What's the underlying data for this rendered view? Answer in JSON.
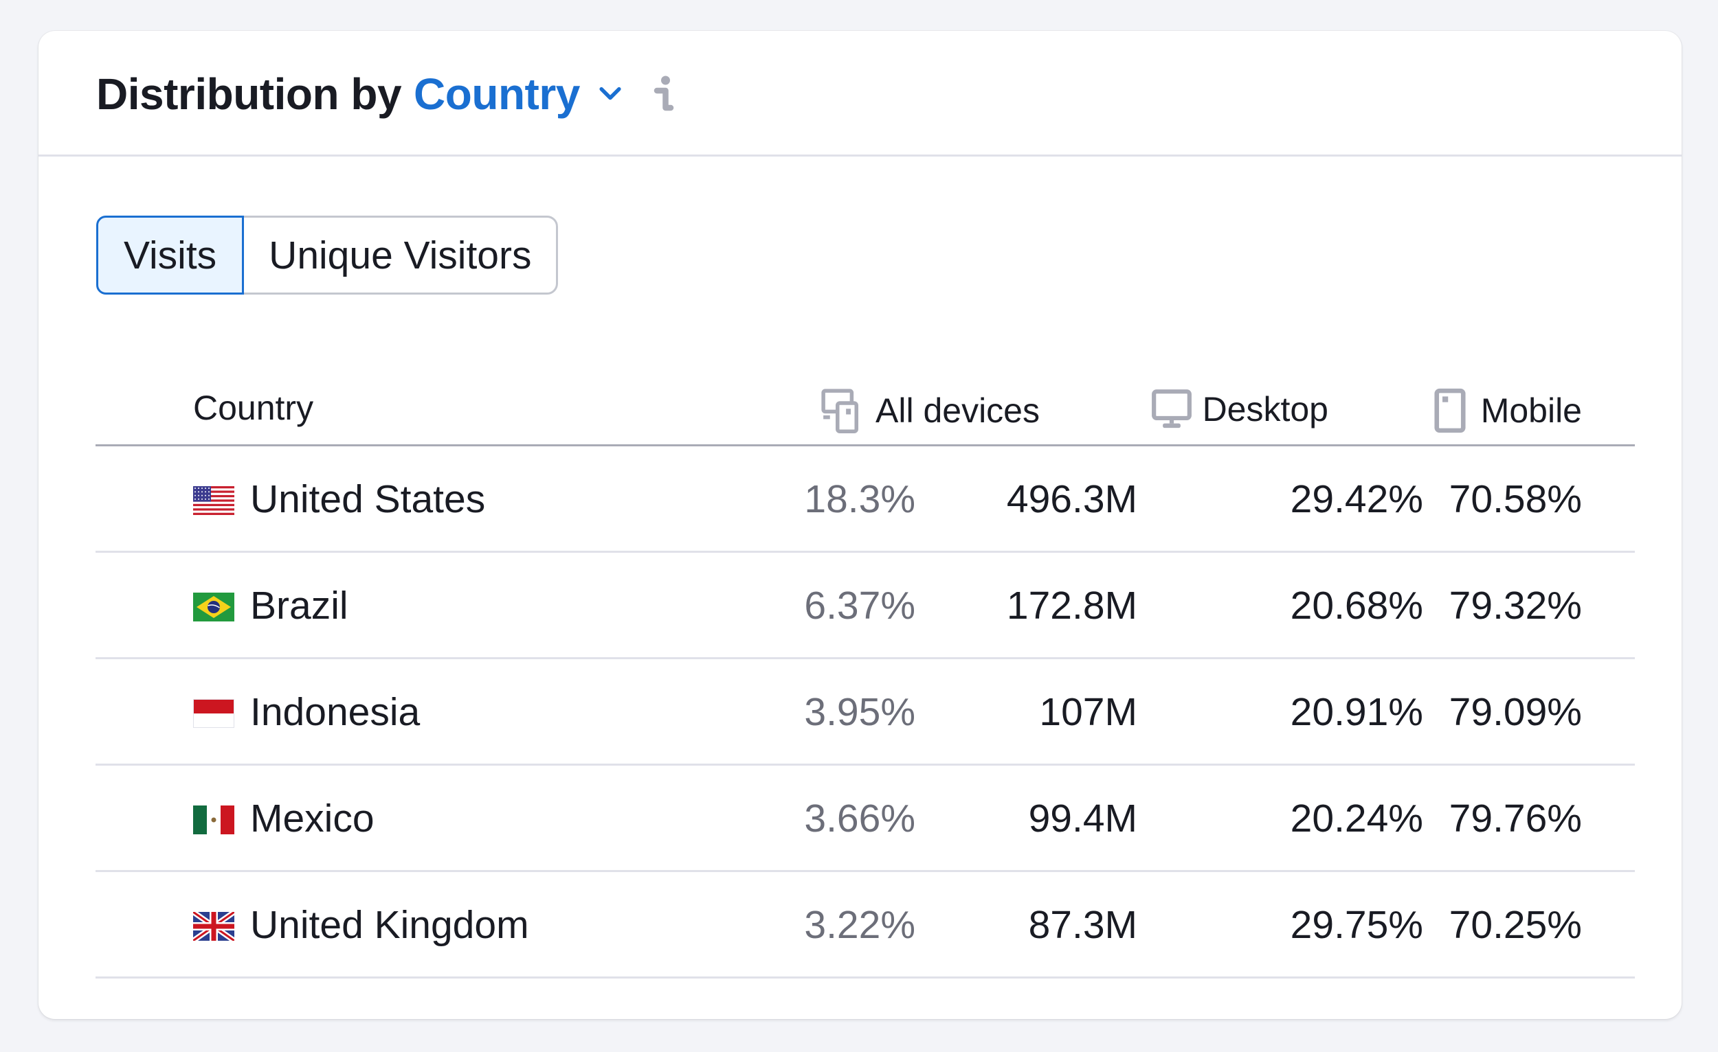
{
  "widget": {
    "title_prefix": "Distribution by",
    "dimension": "Country",
    "icons": {
      "dropdown": "chevron-down-icon",
      "info": "info-icon"
    }
  },
  "toggle": {
    "options": [
      {
        "label": "Visits",
        "active": true
      },
      {
        "label": "Unique Visitors",
        "active": false
      }
    ]
  },
  "table": {
    "columns": {
      "country": "Country",
      "all_devices": "All devices",
      "desktop": "Desktop",
      "mobile": "Mobile"
    },
    "column_icons": {
      "all_devices": "devices-icon",
      "desktop": "desktop-icon",
      "mobile": "mobile-icon"
    },
    "rows": [
      {
        "country": "United States",
        "flag": "us",
        "share": "18.3%",
        "all_devices": "496.3M",
        "desktop": "29.42%",
        "mobile": "70.58%"
      },
      {
        "country": "Brazil",
        "flag": "br",
        "share": "6.37%",
        "all_devices": "172.8M",
        "desktop": "20.68%",
        "mobile": "79.32%"
      },
      {
        "country": "Indonesia",
        "flag": "id",
        "share": "3.95%",
        "all_devices": "107M",
        "desktop": "20.91%",
        "mobile": "79.09%"
      },
      {
        "country": "Mexico",
        "flag": "mx",
        "share": "3.66%",
        "all_devices": "99.4M",
        "desktop": "20.24%",
        "mobile": "79.76%"
      },
      {
        "country": "United Kingdom",
        "flag": "gb",
        "share": "3.22%",
        "all_devices": "87.3M",
        "desktop": "29.75%",
        "mobile": "70.25%"
      }
    ]
  },
  "colors": {
    "accent": "#1a6fd1",
    "active_bg": "#e9f4ff",
    "muted_text": "#6c6e79",
    "icon_gray": "#a9abb6"
  }
}
